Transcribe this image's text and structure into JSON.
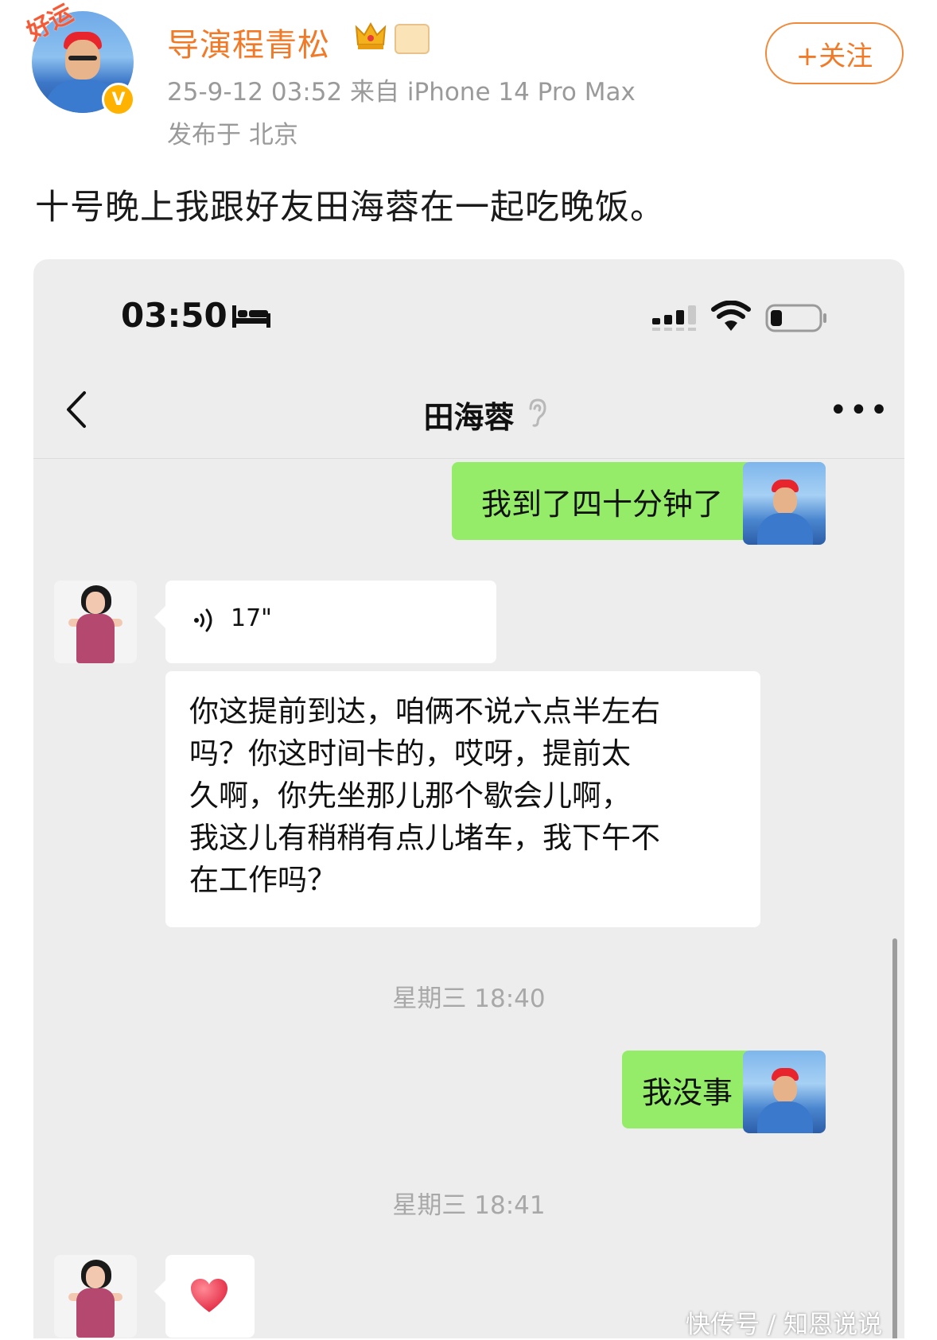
{
  "post": {
    "badge_text": "好运",
    "username": "导演程青松",
    "verified_mark": "V",
    "meta": "25-9-12 03:52  来自 iPhone 14 Pro Max",
    "location": "发布于 北京",
    "follow_label": "+关注",
    "text": "十号晚上我跟好友田海蓉在一起吃晚饭。"
  },
  "chat_screenshot": {
    "status_bar": {
      "time": "03:50",
      "icons": [
        "bed-icon",
        "signal-icon",
        "wifi-icon",
        "battery-icon"
      ]
    },
    "nav": {
      "title": "田海蓉",
      "back_icon": "chevron-left-icon",
      "ear_icon": "ear-icon",
      "more_icon": "more-icon",
      "more_glyph": "•••"
    },
    "messages": [
      {
        "side": "right",
        "type": "text",
        "text": "我到了四十分钟了"
      },
      {
        "side": "left",
        "type": "voice",
        "duration": "17\""
      },
      {
        "side": "left",
        "type": "text",
        "lines": [
          "你这提前到达，咱俩不说六点半左右",
          "吗？你这时间卡的，哎呀，提前太",
          "久啊，你先坐那儿那个歇会儿啊，",
          "我这儿有稍稍有点儿堵车，我下午不",
          "在工作吗？"
        ]
      },
      {
        "type": "timestamp",
        "text": "星期三 18:40"
      },
      {
        "side": "right",
        "type": "text",
        "text": "我没事"
      },
      {
        "type": "timestamp",
        "text": "星期三 18:41"
      },
      {
        "side": "left",
        "type": "emoji",
        "icon": "heart-icon"
      }
    ],
    "colors": {
      "sent_bubble": "#95ec69",
      "received_bubble": "#ffffff",
      "background": "#ededed"
    }
  },
  "watermark": "快传号 / 知恩说说",
  "colors": {
    "accent": "#f07a28",
    "meta": "#9a9a9a"
  }
}
